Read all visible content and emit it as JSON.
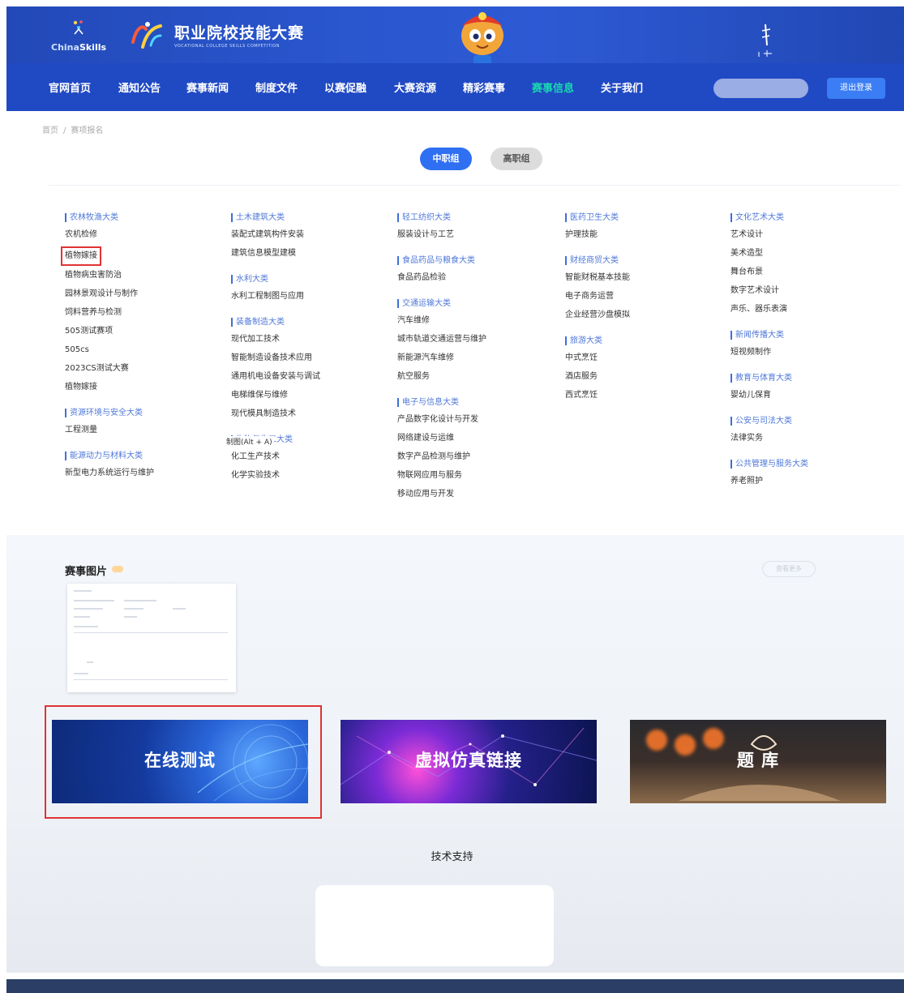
{
  "header": {
    "chinaskills_label_a": "China",
    "chinaskills_label_b": "Skills",
    "title_cn": "职业院校技能大赛",
    "title_en": "VOCATIONAL COLLEGE SKILLS COMPETITION"
  },
  "nav": {
    "items": [
      {
        "label": "官网首页",
        "active": false
      },
      {
        "label": "通知公告",
        "active": false
      },
      {
        "label": "赛事新闻",
        "active": false
      },
      {
        "label": "制度文件",
        "active": false
      },
      {
        "label": "以赛促融",
        "active": false
      },
      {
        "label": "大赛资源",
        "active": false
      },
      {
        "label": "精彩赛事",
        "active": false
      },
      {
        "label": "赛事信息",
        "active": true
      },
      {
        "label": "关于我们",
        "active": false
      }
    ],
    "logout_label": "退出登录"
  },
  "breadcrumb": {
    "home": "首页",
    "current": "赛项报名"
  },
  "toggle": {
    "secondary": "中职组",
    "higher": "高职组"
  },
  "categories": {
    "col1": [
      {
        "head": "农林牧渔大类",
        "items": [
          "农机检修",
          "植物嫁接",
          "植物病虫害防治",
          "园林景观设计与制作",
          "饲料营养与检测",
          "505测试赛项",
          "505cs",
          "2023CS测试大赛",
          "植物嫁接"
        ]
      },
      {
        "head": "资源环境与安全大类",
        "items": [
          "工程测量"
        ]
      },
      {
        "head": "能源动力与材料大类",
        "items": [
          "新型电力系统运行与维护"
        ]
      }
    ],
    "col2": [
      {
        "head": "土木建筑大类",
        "items": [
          "装配式建筑构件安装",
          "建筑信息模型建模"
        ]
      },
      {
        "head": "水利大类",
        "items": [
          "水利工程制图与应用"
        ]
      },
      {
        "head": "装备制造大类",
        "items": [
          "现代加工技术",
          "智能制造设备技术应用",
          "通用机电设备安装与调试",
          "电梯维保与维修",
          "现代模具制造技术"
        ]
      },
      {
        "head": "生物与化工大类",
        "items": [
          "化工生产技术",
          "化学实验技术"
        ]
      }
    ],
    "col3": [
      {
        "head": "轻工纺织大类",
        "items": [
          "服装设计与工艺"
        ]
      },
      {
        "head": "食品药品与粮食大类",
        "items": [
          "食品药品检验"
        ]
      },
      {
        "head": "交通运输大类",
        "items": [
          "汽车维修",
          "城市轨道交通运营与维护",
          "新能源汽车维修",
          "航空服务"
        ]
      },
      {
        "head": "电子与信息大类",
        "items": [
          "产品数字化设计与开发",
          "网络建设与运维",
          "数字产品检测与维护",
          "物联网应用与服务",
          "移动应用与开发"
        ]
      }
    ],
    "col4": [
      {
        "head": "医药卫生大类",
        "items": [
          "护理技能"
        ]
      },
      {
        "head": "财经商贸大类",
        "items": [
          "智能财税基本技能",
          "电子商务运营",
          "企业经营沙盘模拟"
        ]
      },
      {
        "head": "旅游大类",
        "items": [
          "中式烹饪",
          "酒店服务",
          "西式烹饪"
        ]
      }
    ],
    "col5": [
      {
        "head": "文化艺术大类",
        "items": [
          "艺术设计",
          "美术造型",
          "舞台布景",
          "数字艺术设计",
          "声乐、器乐表演"
        ]
      },
      {
        "head": "新闻传播大类",
        "items": [
          "短视频制作"
        ]
      },
      {
        "head": "教育与体育大类",
        "items": [
          "婴幼儿保育"
        ]
      },
      {
        "head": "公安与司法大类",
        "items": [
          "法律实务"
        ]
      },
      {
        "head": "公共管理与服务大类",
        "items": [
          "养老照护"
        ]
      }
    ],
    "tooltip": "制图(Alt + A)"
  },
  "gallery": {
    "title": "赛事图片",
    "more": "查看更多"
  },
  "banners": [
    {
      "label": "在线测试"
    },
    {
      "label": "虚拟仿真链接"
    },
    {
      "label": "题 库"
    }
  ],
  "support": {
    "title": "技术支持"
  },
  "colors": {
    "primary": "#2049c4",
    "accent": "#19d6b1",
    "highlight": "#e03333",
    "button": "#2f6ff2"
  }
}
